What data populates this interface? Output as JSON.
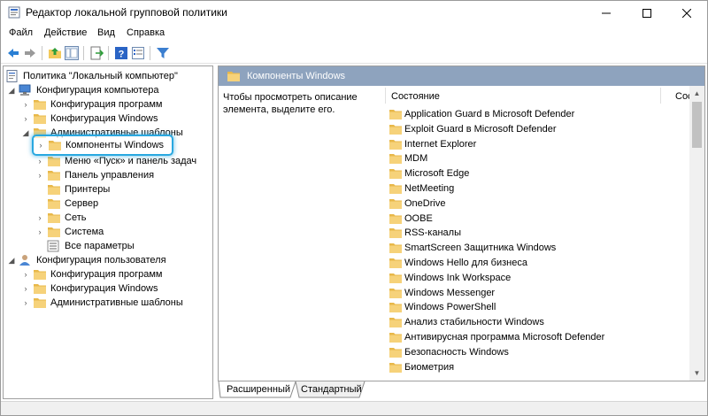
{
  "window": {
    "title": "Редактор локальной групповой политики"
  },
  "menu": [
    "Файл",
    "Действие",
    "Вид",
    "Справка"
  ],
  "toolbar": {
    "icons": [
      "back-arrow-icon",
      "forward-arrow-icon",
      "up-folder-icon",
      "show-hide-tree-icon",
      "export-list-icon",
      "help-icon",
      "properties-icon",
      "filter-icon"
    ]
  },
  "tree": {
    "root": "Политика \"Локальный компьютер\"",
    "computer_config": "Конфигурация компьютера",
    "cc_programs": "Конфигурация программ",
    "cc_windows": "Конфигурация Windows",
    "cc_admin": "Административные шаблоны",
    "cc_components": "Компоненты Windows",
    "cc_start": "Меню «Пуск» и панель задач",
    "cc_control": "Панель управления",
    "cc_printers": "Принтеры",
    "cc_server": "Сервер",
    "cc_network": "Сеть",
    "cc_system": "Система",
    "cc_all": "Все параметры",
    "user_config": "Конфигурация пользователя",
    "uc_programs": "Конфигурация программ",
    "uc_windows": "Конфигурация Windows",
    "uc_admin": "Административные шаблоны"
  },
  "right": {
    "header": "Компоненты Windows",
    "description": "Чтобы просмотреть описание элемента, выделите его.",
    "col_state": "Состояние",
    "col_state2": "Сос",
    "items": [
      "Application Guard в Microsoft Defender",
      "Exploit Guard в Microsoft Defender",
      "Internet Explorer",
      "MDM",
      "Microsoft Edge",
      "NetMeeting",
      "OneDrive",
      "OOBE",
      "RSS-каналы",
      "SmartScreen Защитника Windows",
      "Windows Hello для бизнеса",
      "Windows Ink Workspace",
      "Windows Messenger",
      "Windows PowerShell",
      "Анализ стабильности Windows",
      "Антивирусная программа Microsoft Defender",
      "Безопасность Windows",
      "Биометрия"
    ]
  },
  "tabs": {
    "extended": "Расширенный",
    "standard": "Стандартный"
  },
  "colors": {
    "header_bg": "#8ea3be",
    "highlight": "#29a8e0",
    "folder": "#f3c95a"
  }
}
